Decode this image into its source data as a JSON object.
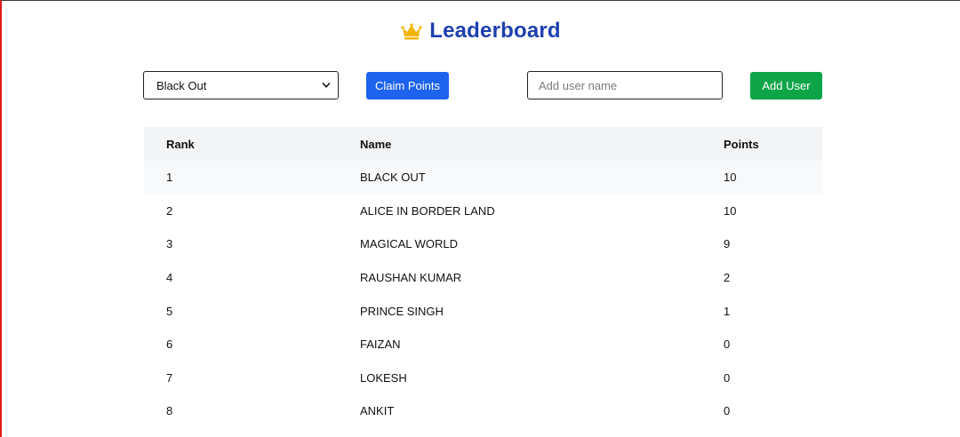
{
  "header": {
    "crown_icon": "crown-icon",
    "title": "Leaderboard",
    "title_color": "#1e40af"
  },
  "controls": {
    "selected_user": "Black Out",
    "claim_label": "Claim Points",
    "claim_color": "#1d63ed",
    "name_placeholder": "Add user name",
    "name_value": "",
    "add_label": "Add User",
    "add_color": "#0ea548"
  },
  "table": {
    "headers": [
      "Rank",
      "Name",
      "Points"
    ],
    "rows": [
      {
        "rank": "1",
        "name": "BLACK OUT",
        "points": "10"
      },
      {
        "rank": "2",
        "name": "ALICE IN BORDER LAND",
        "points": "10"
      },
      {
        "rank": "3",
        "name": "MAGICAL WORLD",
        "points": "9"
      },
      {
        "rank": "4",
        "name": "RAUSHAN KUMAR",
        "points": "2"
      },
      {
        "rank": "5",
        "name": "PRINCE SINGH",
        "points": "1"
      },
      {
        "rank": "6",
        "name": "FAIZAN",
        "points": "0"
      },
      {
        "rank": "7",
        "name": "LOKESH",
        "points": "0"
      },
      {
        "rank": "8",
        "name": "ANKIT",
        "points": "0"
      }
    ]
  }
}
